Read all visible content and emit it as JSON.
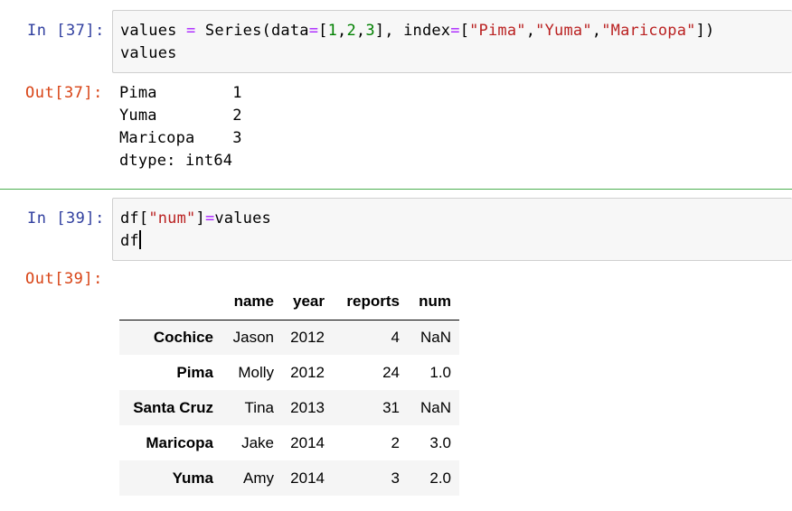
{
  "cell1": {
    "in_prompt": "In [37]:",
    "code_line1": {
      "a": "values ",
      "eq1": "=",
      "b": " Series(data",
      "eq2": "=",
      "c": "[",
      "n1": "1",
      "c1": ",",
      "n2": "2",
      "c2": ",",
      "n3": "3",
      "d": "], index",
      "eq3": "=",
      "e": "[",
      "s1": "\"Pima\"",
      "c3": ",",
      "s2": "\"Yuma\"",
      "c4": ",",
      "s3": "\"Maricopa\"",
      "f": "])"
    },
    "code_line2": "values",
    "out_prompt": "Out[37]:",
    "output_lines": [
      "Pima        1",
      "Yuma        2",
      "Maricopa    3",
      "dtype: int64"
    ]
  },
  "cell2": {
    "in_prompt": "In [39]:",
    "code_line1": {
      "a": "df[",
      "s1": "\"num\"",
      "b": "]",
      "eq": "=",
      "c": "values"
    },
    "code_line2": "df",
    "out_prompt": "Out[39]:",
    "table": {
      "columns": [
        "",
        "name",
        "year",
        "reports",
        "num"
      ],
      "rows": [
        {
          "index": "Cochice",
          "name": "Jason",
          "year": "2012",
          "reports": "4",
          "num": "NaN"
        },
        {
          "index": "Pima",
          "name": "Molly",
          "year": "2012",
          "reports": "24",
          "num": "1.0"
        },
        {
          "index": "Santa Cruz",
          "name": "Tina",
          "year": "2013",
          "reports": "31",
          "num": "NaN"
        },
        {
          "index": "Maricopa",
          "name": "Jake",
          "year": "2014",
          "reports": "2",
          "num": "3.0"
        },
        {
          "index": "Yuma",
          "name": "Amy",
          "year": "2014",
          "reports": "3",
          "num": "2.0"
        }
      ]
    }
  },
  "colors": {
    "in_prompt": "#303f9f",
    "out_prompt": "#d84315",
    "selected_cell_border": "#4caf50",
    "input_background": "#f7f7f7"
  }
}
